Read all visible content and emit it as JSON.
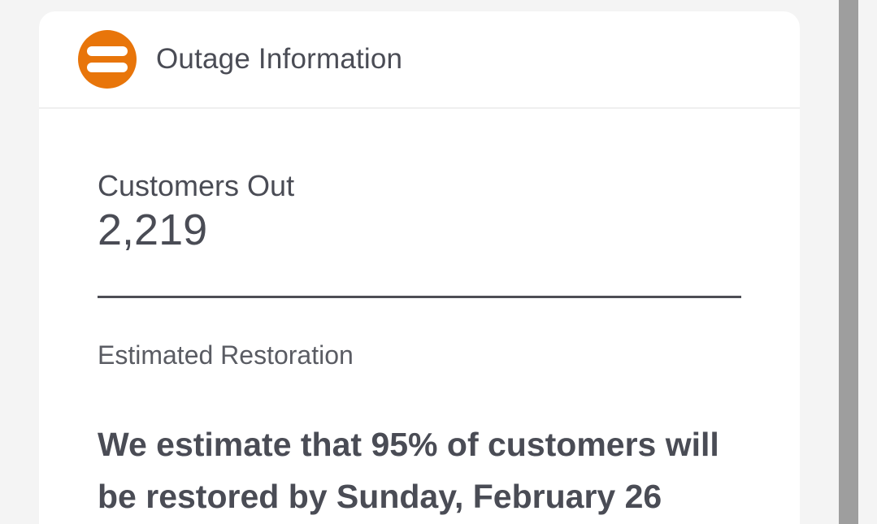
{
  "header": {
    "icon": "outage-icon",
    "title": "Outage Information"
  },
  "stats": {
    "customers_out_label": "Customers Out",
    "customers_out_value": "2,219"
  },
  "restoration": {
    "label": "Estimated Restoration",
    "text": "We estimate that 95% of customers will be restored by Sunday, February 26"
  },
  "colors": {
    "accent": "#e8750a",
    "text": "#4a4c55",
    "card": "#ffffff",
    "background": "#f4f4f4",
    "scrollbar": "#9e9e9e"
  }
}
